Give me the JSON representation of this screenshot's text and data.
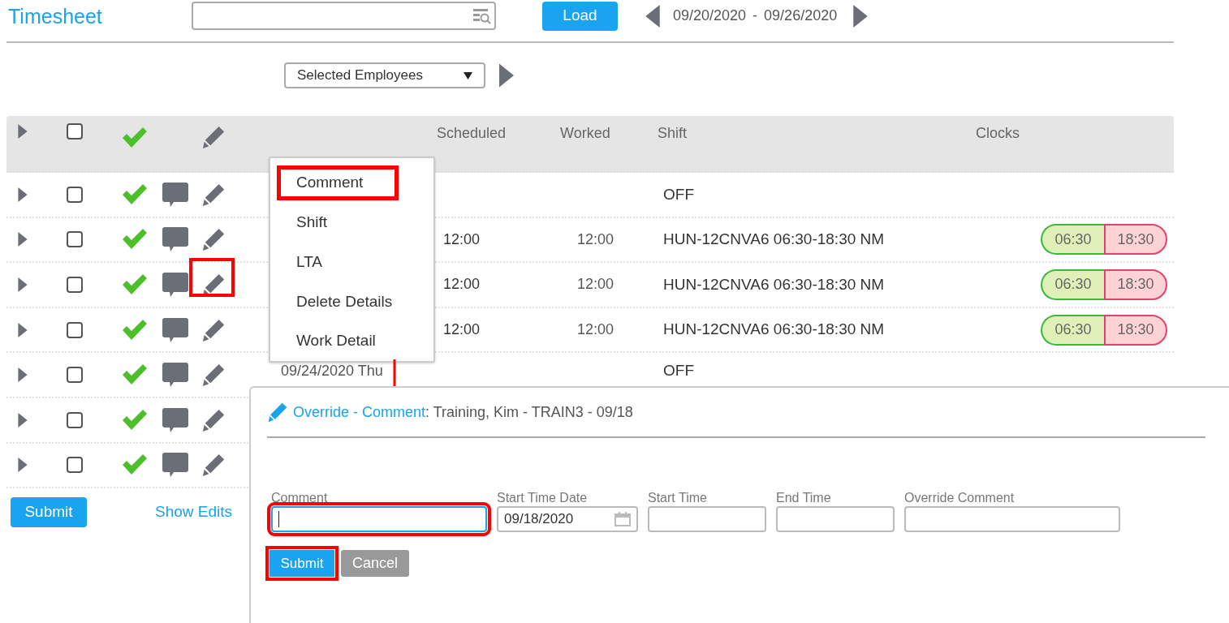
{
  "header": {
    "title": "Timesheet",
    "load_button": "Load",
    "date_from": "09/20/2020",
    "date_separator": "-",
    "date_to": "09/26/2020"
  },
  "filter": {
    "value": "Selected Employees"
  },
  "table": {
    "header": {
      "checked": false
    },
    "columns": [
      "Scheduled",
      "Worked",
      "Shift",
      "Clocks"
    ],
    "rows": [
      {
        "checked": false,
        "approved": true,
        "edit_highlighted": false,
        "shift": "OFF"
      },
      {
        "checked": false,
        "approved": true,
        "edit_highlighted": false,
        "scheduled": "12:00",
        "worked": "12:00",
        "shift": "HUN-12CNVA6 06:30-18:30 NM",
        "clock_in": "06:30",
        "clock_out": "18:30"
      },
      {
        "checked": false,
        "approved": true,
        "edit_highlighted": true,
        "scheduled": "12:00",
        "worked": "12:00",
        "shift": "HUN-12CNVA6 06:30-18:30 NM",
        "clock_in": "06:30",
        "clock_out": "18:30"
      },
      {
        "checked": false,
        "approved": true,
        "edit_highlighted": false,
        "scheduled": "12:00",
        "worked": "12:00",
        "shift": "HUN-12CNVA6 06:30-18:30 NM",
        "clock_in": "06:30",
        "clock_out": "18:30"
      },
      {
        "checked": false,
        "approved": true,
        "edit_highlighted": false,
        "date": "09/24/2020 Thu",
        "shift": "OFF"
      },
      {
        "checked": false,
        "approved": true,
        "edit_highlighted": false
      },
      {
        "checked": false,
        "approved": true,
        "edit_highlighted": false
      }
    ]
  },
  "footer": {
    "submit_button": "Submit",
    "show_edits_link": "Show Edits"
  },
  "menu": {
    "items": [
      {
        "label": "Comment",
        "highlighted": true
      },
      {
        "label": "Shift",
        "highlighted": false
      },
      {
        "label": "LTA",
        "highlighted": false
      },
      {
        "label": "Delete Details",
        "highlighted": false
      },
      {
        "label": "Work Detail",
        "highlighted": false
      }
    ]
  },
  "dialog": {
    "heading": "Override - Comment",
    "subject": ": Training, Kim - TRAIN3 - 09/18",
    "fields": [
      {
        "kind": "text",
        "label": "Comment",
        "focused": true,
        "highlighted": true
      },
      {
        "kind": "date",
        "label": "Start Time Date",
        "value": "09/18/2020",
        "focused": false,
        "highlighted": false
      },
      {
        "kind": "text",
        "label": "Start Time",
        "focused": false,
        "highlighted": false
      },
      {
        "kind": "text",
        "label": "End Time",
        "focused": false,
        "highlighted": false
      },
      {
        "kind": "wide",
        "label": "Override Comment",
        "focused": false,
        "highlighted": false
      }
    ],
    "submit_button": {
      "label": "Submit",
      "highlighted": true
    },
    "cancel_button": "Cancel"
  }
}
